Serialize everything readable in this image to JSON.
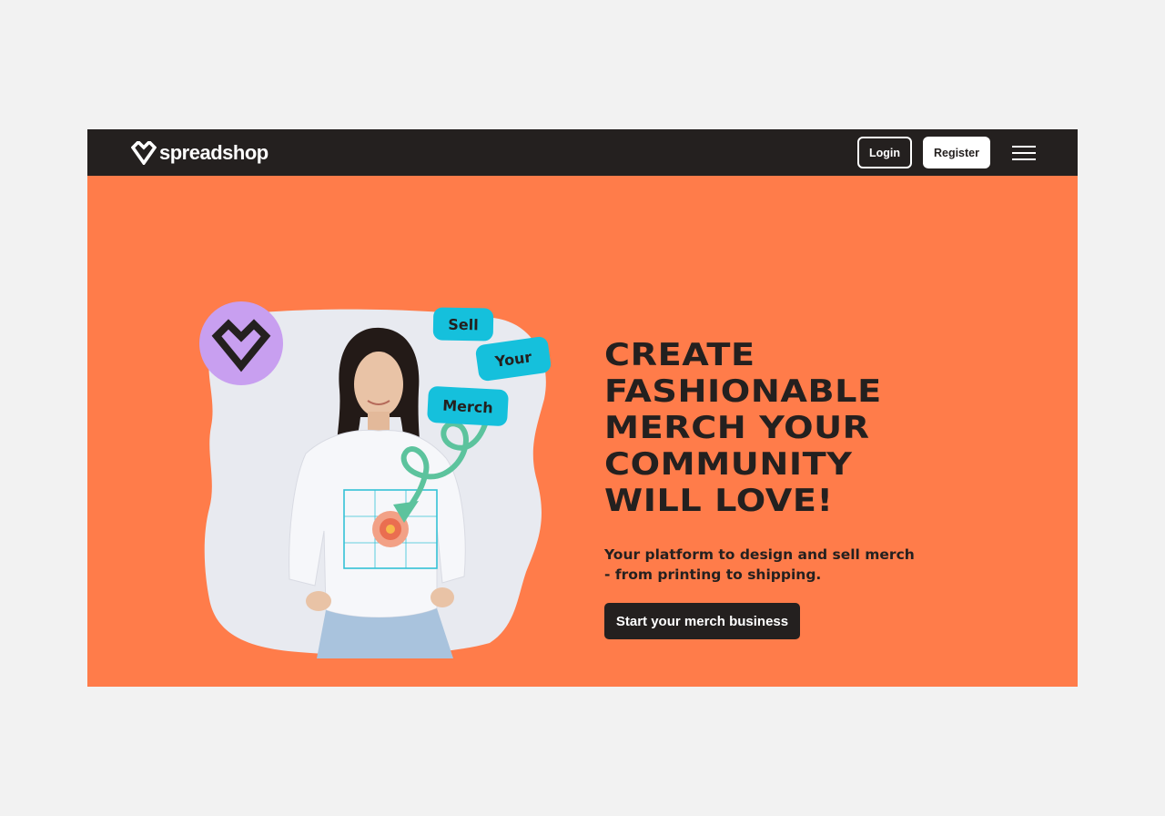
{
  "header": {
    "logo_text": "spreadshop",
    "logo_icon": "heart-icon",
    "login_label": "Login",
    "register_label": "Register",
    "menu_icon": "hamburger-menu-icon"
  },
  "hero": {
    "headline_lines": [
      "CREATE",
      "FASHIONABLE",
      "MERCH YOUR",
      "COMMUNITY",
      "WILL LOVE!"
    ],
    "subline_lines": [
      "Your platform to design and sell merch",
      "- from printing to shipping."
    ],
    "cta_label": "Start your merch business",
    "tags": [
      "Sell",
      "Your",
      "Merch"
    ],
    "badge_icon": "heart-icon",
    "image_alt": "Woman wearing a white sweatshirt with a printed flower design"
  },
  "colors": {
    "nav_background": "#24201f",
    "hero_background": "#ff7c4a",
    "tag_background": "#15c0dc",
    "badge_background": "#c89ff0",
    "arrow": "#5cc39d",
    "text_dark": "#24201f",
    "page_background": "#f2f2f2"
  }
}
